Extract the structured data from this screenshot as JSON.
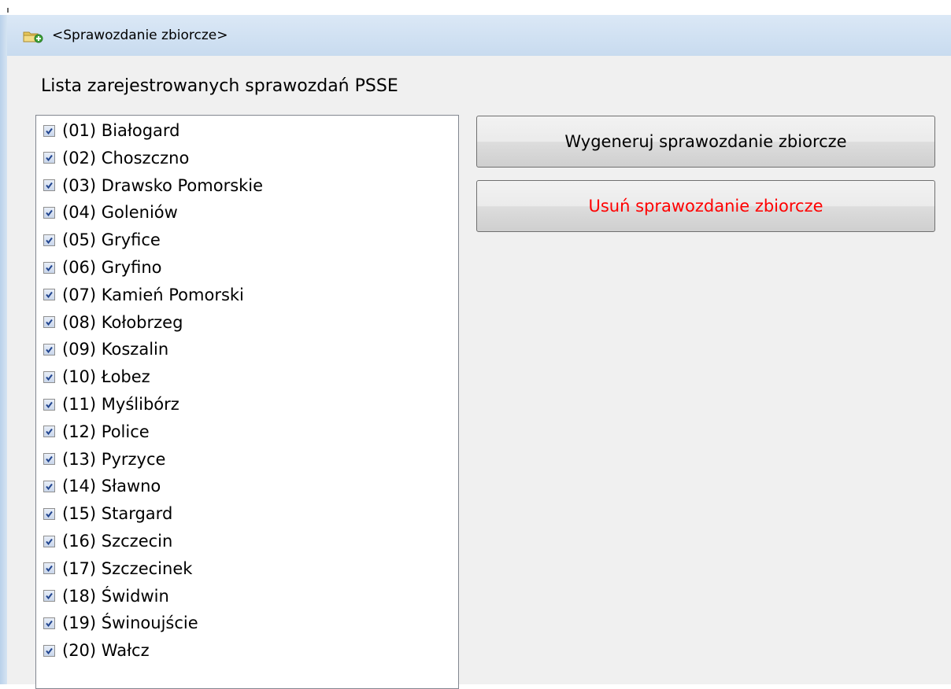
{
  "window": {
    "title": "<Sprawozdanie zbiorcze>",
    "icon": "folder-add-icon"
  },
  "list": {
    "label": "Lista zarejestrowanych sprawozdań PSSE",
    "items": [
      {
        "label": "(01) Białogard",
        "checked": true
      },
      {
        "label": "(02) Choszczno",
        "checked": true
      },
      {
        "label": "(03) Drawsko Pomorskie",
        "checked": true
      },
      {
        "label": "(04) Goleniów",
        "checked": true
      },
      {
        "label": "(05) Gryfice",
        "checked": true
      },
      {
        "label": "(06) Gryfino",
        "checked": true
      },
      {
        "label": "(07) Kamień Pomorski",
        "checked": true
      },
      {
        "label": "(08) Kołobrzeg",
        "checked": true
      },
      {
        "label": "(09) Koszalin",
        "checked": true
      },
      {
        "label": "(10) Łobez",
        "checked": true
      },
      {
        "label": "(11) Myślibórz",
        "checked": true
      },
      {
        "label": "(12) Police",
        "checked": true
      },
      {
        "label": "(13) Pyrzyce",
        "checked": true
      },
      {
        "label": "(14) Sławno",
        "checked": true
      },
      {
        "label": "(15) Stargard",
        "checked": true
      },
      {
        "label": "(16) Szczecin",
        "checked": true
      },
      {
        "label": "(17) Szczecinek",
        "checked": true
      },
      {
        "label": "(18) Świdwin",
        "checked": true
      },
      {
        "label": "(19) Świnoujście",
        "checked": true
      },
      {
        "label": "(20) Wałcz",
        "checked": true
      }
    ]
  },
  "buttons": {
    "generate_label": "Wygeneruj sprawozdanie zbiorcze",
    "delete_label": "Usuń sprawozdanie zbiorcze"
  },
  "colors": {
    "delete_text": "#ff0000",
    "checkmark": "#21458f",
    "titlebar": "#c8dbef"
  }
}
